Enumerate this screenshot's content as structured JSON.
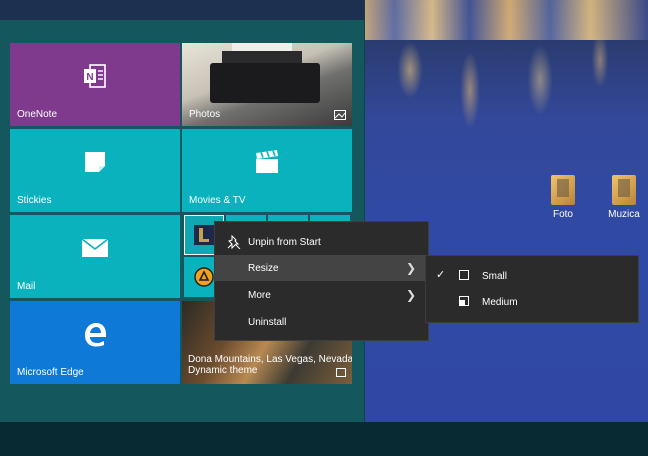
{
  "start_tiles": {
    "onenote": "OneNote",
    "photos": "Photos",
    "stickies": "Stickies",
    "movies": "Movies & TV",
    "mail": "Mail",
    "edge": "Microsoft Edge",
    "news_headline": "Dona Mountains, Las Vegas, Nevada",
    "news_overlay": "Dynamic theme"
  },
  "desktop_icons": [
    {
      "label": "Foto"
    },
    {
      "label": "Muzica"
    }
  ],
  "context_menu": {
    "items": [
      {
        "label": "Unpin from Start",
        "icon": "unpin-icon"
      },
      {
        "label": "Resize",
        "submenu": true,
        "active": true
      },
      {
        "label": "More",
        "submenu": true
      },
      {
        "label": "Uninstall"
      }
    ]
  },
  "resize_submenu": {
    "items": [
      {
        "label": "Small",
        "checked": true
      },
      {
        "label": "Medium",
        "checked": false
      }
    ]
  },
  "colors": {
    "onenote": "#7f3a8d",
    "teal_tile": "#0ab2be",
    "edge": "#0e79d6",
    "menu_bg": "#2b2b2b",
    "menu_hover": "#444444"
  }
}
